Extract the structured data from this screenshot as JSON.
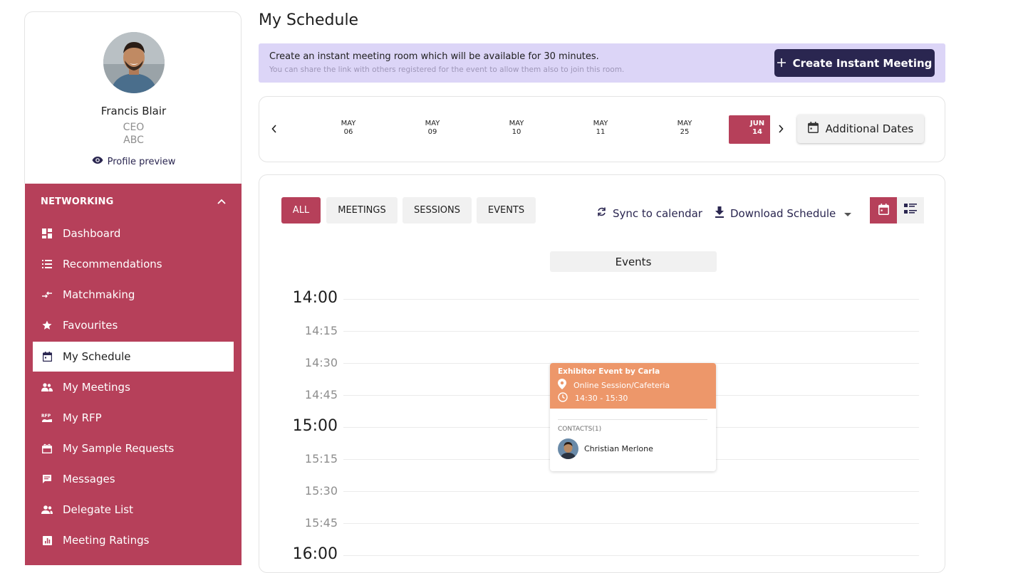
{
  "profile": {
    "name": "Francis Blair",
    "role": "CEO",
    "organization": "ABC",
    "preview_label": "Profile preview"
  },
  "nav": {
    "section_label": "NETWORKING",
    "items": [
      {
        "label": "Dashboard",
        "icon": "dashboard-icon"
      },
      {
        "label": "Recommendations",
        "icon": "list-icon"
      },
      {
        "label": "Matchmaking",
        "icon": "swap-icon"
      },
      {
        "label": "Favourites",
        "icon": "star-icon"
      },
      {
        "label": "My Schedule",
        "icon": "calendar-icon",
        "active": true
      },
      {
        "label": "My Meetings",
        "icon": "people-icon"
      },
      {
        "label": "My RFP",
        "icon": "rfp-icon"
      },
      {
        "label": "My Sample Requests",
        "icon": "gift-icon"
      },
      {
        "label": "Messages",
        "icon": "message-icon"
      },
      {
        "label": "Delegate List",
        "icon": "group-icon"
      },
      {
        "label": "Meeting Ratings",
        "icon": "chart-icon"
      }
    ]
  },
  "page": {
    "title": "My Schedule"
  },
  "banner": {
    "title": "Create an instant meeting room which will be available for 30 minutes.",
    "subtitle": "You can share the link with others registered for the event to allow them also to join this room.",
    "button_label": "Create Instant Meeting"
  },
  "dates": {
    "items": [
      {
        "month": "MAY",
        "day": "06"
      },
      {
        "month": "MAY",
        "day": "09"
      },
      {
        "month": "MAY",
        "day": "10"
      },
      {
        "month": "MAY",
        "day": "11"
      },
      {
        "month": "MAY",
        "day": "25"
      },
      {
        "month": "JUN",
        "day": "14",
        "selected": true
      }
    ],
    "additional_label": "Additional Dates"
  },
  "filters": {
    "items": [
      "ALL",
      "MEETINGS",
      "SESSIONS",
      "EVENTS"
    ],
    "active": "ALL"
  },
  "actions": {
    "sync_label": "Sync to calendar",
    "download_label": "Download Schedule"
  },
  "calendar": {
    "column_header": "Events",
    "times": [
      "14:00",
      "14:15",
      "14:30",
      "14:45",
      "15:00",
      "15:15",
      "15:30",
      "15:45",
      "16:00"
    ]
  },
  "event": {
    "title": "Exhibitor Event by Carla",
    "location": "Online Session/Cafeteria",
    "time": "14:30 - 15:30",
    "contacts_label": "CONTACTS(1)",
    "contact_name": "Christian Merlone"
  },
  "colors": {
    "brand": "#b6405a",
    "navy": "#2a2650",
    "banner_bg": "#dcd5f7",
    "event_bg": "#ed976a"
  }
}
